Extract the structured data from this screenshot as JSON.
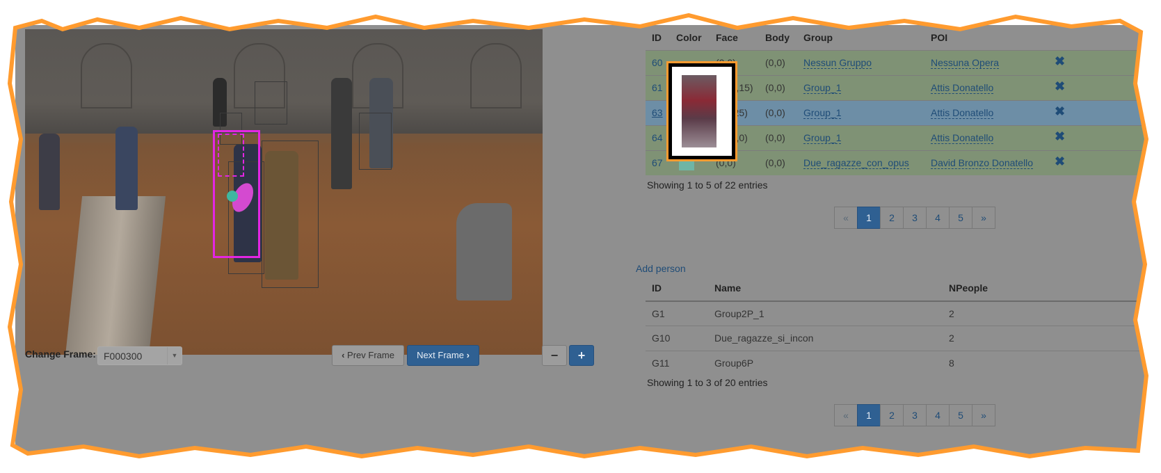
{
  "video": {
    "frame_label": "Change Frame:",
    "frame_value": "F000300"
  },
  "controls": {
    "prev_label": "Prev Frame",
    "next_label": "Next Frame"
  },
  "people_table": {
    "headers": {
      "id": "ID",
      "color": "Color",
      "face": "Face",
      "body": "Body",
      "group": "Group",
      "poi": "POI"
    },
    "rows": [
      {
        "id": "60",
        "face": "(0,0)",
        "body": "(0,0)",
        "group": "Nessun Gruppo",
        "poi": "Nessuna Opera"
      },
      {
        "id": "61",
        "face": "(5,15)",
        "body": "(0,0)",
        "group": "Group_1",
        "poi": "Attis Donatello"
      },
      {
        "id": "63",
        "face": "(,25)",
        "body": "(0,0)",
        "group": "Group_1",
        "poi": "Attis Donatello"
      },
      {
        "id": "64",
        "face": "(5,0)",
        "body": "(0,0)",
        "group": "Group_1",
        "poi": "Attis Donatello"
      },
      {
        "id": "67",
        "face": "(0,0)",
        "body": "(0,0)",
        "group": "Due_ragazze_con_opus",
        "poi": "David Bronzo Donatello"
      }
    ],
    "info": "Showing 1 to 5 of 22 entries",
    "pager": [
      "«",
      "1",
      "2",
      "3",
      "4",
      "5",
      "»"
    ]
  },
  "add_person_label": "Add person",
  "groups_table": {
    "headers": {
      "id": "ID",
      "name": "Name",
      "npeople": "NPeople"
    },
    "rows": [
      {
        "id": "G1",
        "name": "Group2P_1",
        "npeople": "2"
      },
      {
        "id": "G10",
        "name": "Due_ragazze_si_incon",
        "npeople": "2"
      },
      {
        "id": "G11",
        "name": "Group6P",
        "npeople": "8"
      }
    ],
    "info": "Showing 1 to 3 of 20 entries",
    "pager": [
      "«",
      "1",
      "2",
      "3",
      "4",
      "5",
      "»"
    ]
  },
  "icons": {
    "remove": "close-icon",
    "prev": "chevron-left-icon",
    "next": "chevron-right-icon",
    "zoom_out": "minus-icon",
    "zoom_in": "plus-icon"
  },
  "colors": {
    "selected_row": "#6d8ea6",
    "active_row": "#7f9275",
    "primary": "#2f6092",
    "highlight_box": "#e326e3",
    "swatch_67": "#6fb5a5"
  }
}
